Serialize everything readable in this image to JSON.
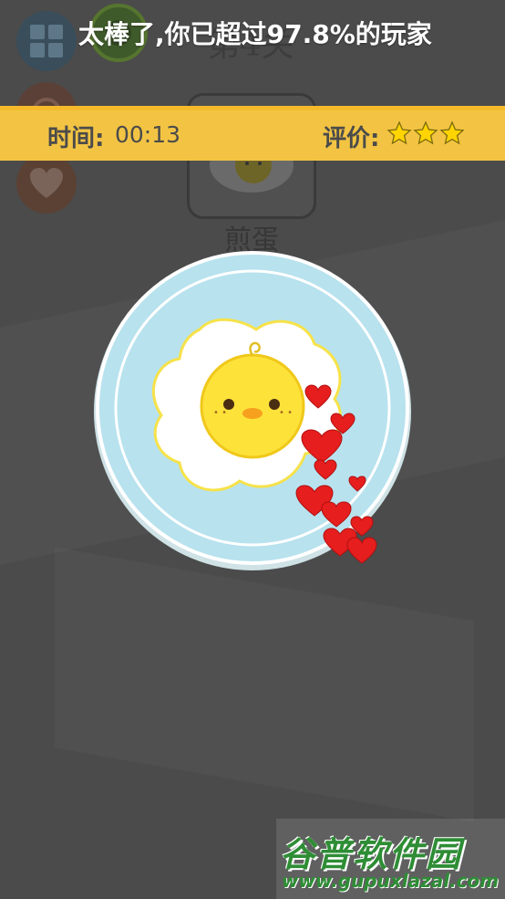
{
  "banner": {
    "message": "太棒了,你已超过97.8%的玩家"
  },
  "status": {
    "time_label": "时间:",
    "time_value": "00:13",
    "rating_label": "评价:",
    "rating_stars": 3,
    "rating_max": 3
  },
  "level": {
    "title": "第4关",
    "name": "煎蛋"
  },
  "icons": {
    "menu": "grid-icon",
    "coin": "coin-icon",
    "sound": "sound-icon",
    "favorite": "heart-icon",
    "rating": "star-icon"
  },
  "colors": {
    "background": "#4b4b4b",
    "status_bar": "#f3c443",
    "plate": "#b7e2ee",
    "egg_yolk": "#fde23a",
    "heart": "#e61e1e",
    "star": "#ffd400"
  },
  "watermark": {
    "title": "谷普软件园",
    "url": "www.gupuxlazal.com"
  }
}
